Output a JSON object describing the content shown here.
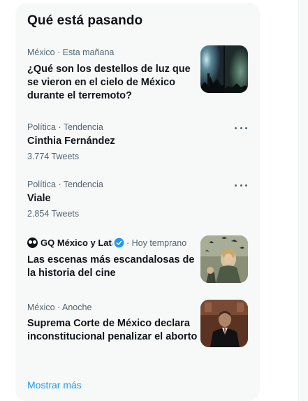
{
  "panel": {
    "title": "Qué está pasando",
    "show_more": "Mostrar más"
  },
  "trends": [
    {
      "meta": "México · Esta mañana",
      "headline": "¿Qué son los destellos de luz que se vieron en el cielo de México durante el terremoto?",
      "image": "night-sky-flashes-photo"
    },
    {
      "meta": "Política · Tendencia",
      "headline": "Cinthia Fernández",
      "count": "3.774 Tweets"
    },
    {
      "meta": "Política · Tendencia",
      "headline": "Viale",
      "count": "2.854 Tweets"
    },
    {
      "source": "GQ México y Latam",
      "time": "· Hoy temprano",
      "headline": "Las escenas más escandalosas de la historia del cine",
      "image": "film-scene-birds-photo"
    },
    {
      "meta": "México · Anoche",
      "headline": "Suprema Corte de México declara inconstitucional penalizar el aborto",
      "image": "court-judge-photo"
    }
  ],
  "colors": {
    "accent": "#1d9bf0",
    "panel_bg": "#f7f9f9",
    "text": "#0f1419",
    "muted": "#536471"
  }
}
